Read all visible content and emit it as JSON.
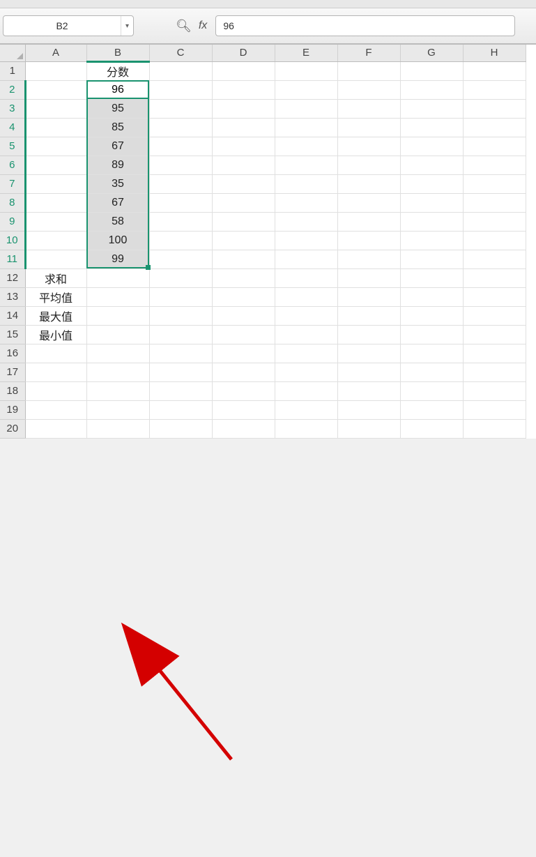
{
  "namebox": {
    "value": "B2"
  },
  "formula_bar": {
    "value": "96",
    "fx_label": "fx"
  },
  "columns": [
    "A",
    "B",
    "C",
    "D",
    "E",
    "F",
    "G",
    "H"
  ],
  "row_count": 20,
  "selected_col_index": 1,
  "selected_rows_from": 2,
  "selected_rows_to": 11,
  "cells": {
    "B1": "分数",
    "B2": "96",
    "B3": "95",
    "B4": "85",
    "B5": "67",
    "B6": "89",
    "B7": "35",
    "B8": "67",
    "B9": "58",
    "B10": "100",
    "B11": "99",
    "A12": "求和",
    "A13": "平均值",
    "A14": "最大值",
    "A15": "最小值"
  },
  "chart_data": {
    "type": "table",
    "title": "分数",
    "values": [
      96,
      95,
      85,
      67,
      89,
      35,
      67,
      58,
      100,
      99
    ],
    "stats_labels": [
      "求和",
      "平均值",
      "最大值",
      "最小值"
    ]
  }
}
